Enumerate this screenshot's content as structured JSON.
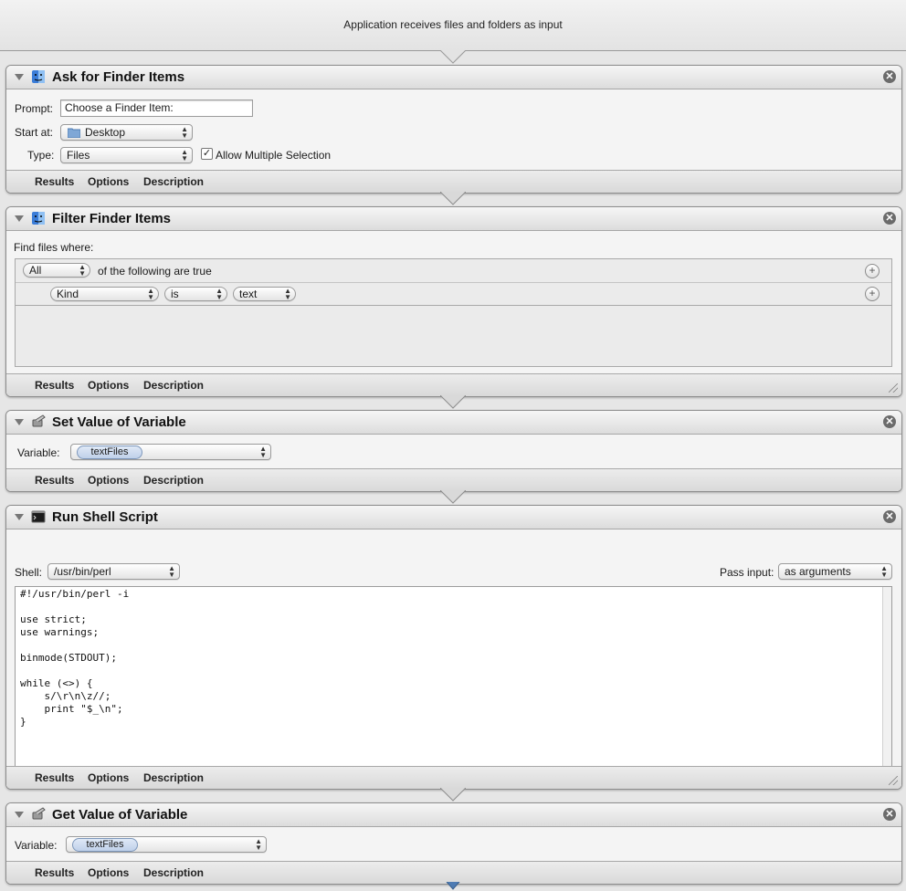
{
  "workflow_header": "Application receives files and folders as input",
  "footer_tabs": {
    "results": "Results",
    "options": "Options",
    "description": "Description"
  },
  "close_glyph": "✕",
  "actions": {
    "ask": {
      "title": "Ask for Finder Items",
      "prompt_label": "Prompt:",
      "prompt_value": "Choose a Finder Item:",
      "start_label": "Start at:",
      "start_value": "Desktop",
      "type_label": "Type:",
      "type_value": "Files",
      "allow_multiple": "Allow Multiple Selection",
      "allow_multiple_checked": true
    },
    "filter": {
      "title": "Filter Finder Items",
      "find_label": "Find files where:",
      "match_value": "All",
      "match_suffix": "of the following are true",
      "criterion": {
        "field": "Kind",
        "operator": "is",
        "value": "text"
      }
    },
    "setvar": {
      "title": "Set Value of Variable",
      "variable_label": "Variable:",
      "variable_value": "textFiles"
    },
    "shell": {
      "title": "Run Shell Script",
      "shell_label": "Shell:",
      "shell_value": "/usr/bin/perl",
      "pass_label": "Pass input:",
      "pass_value": "as arguments",
      "script": "#!/usr/bin/perl -i\n\nuse strict;\nuse warnings;\n\nbinmode(STDOUT);\n\nwhile (<>) {\n    s/\\r\\n\\z//;\n    print \"$_\\n\";\n}"
    },
    "getvar": {
      "title": "Get Value of Variable",
      "variable_label": "Variable:",
      "variable_value": "textFiles"
    }
  },
  "icons": {
    "finder": "finder-icon",
    "variable": "variable-icon",
    "terminal": "terminal-icon"
  }
}
